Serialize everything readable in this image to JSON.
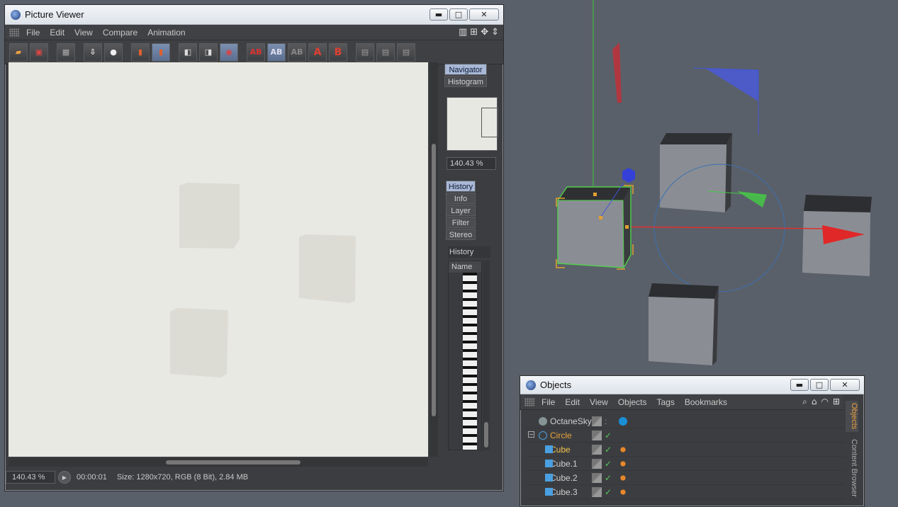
{
  "picture_viewer": {
    "title": "Picture Viewer",
    "menu": [
      "File",
      "Edit",
      "View",
      "Compare",
      "Animation"
    ],
    "window_buttons": {
      "minimize": "▬",
      "maximize": "□",
      "close": "✕"
    },
    "toolbar_tools": [
      "open-icon",
      "save-icon",
      "grid-icon",
      "export-icon",
      "user-icon",
      "film-icon",
      "filmstrip-icon",
      "view-a-icon",
      "view-b-icon",
      "view-ab-icon",
      "ab-icon",
      "ab-split-icon",
      "ab-compare-icon",
      "set-a-icon",
      "set-b-icon",
      "layout-1-icon",
      "layout-2-icon",
      "layout-3-icon"
    ],
    "tool_labels": {
      "ab": "AB",
      "a": "A",
      "b": "B"
    },
    "side_tabs": {
      "navigator": "Navigator",
      "histogram": "Histogram"
    },
    "nav_zoom": "140.43 %",
    "history_tabs": [
      "History",
      "Info",
      "Layer",
      "Filter",
      "Stereo"
    ],
    "history_label": "History",
    "history_column": "Name",
    "status": {
      "zoom": "140.43 %",
      "time": "00:00:01",
      "info": "Size: 1280x720, RGB (8 Bit), 2.84 MB"
    }
  },
  "objects": {
    "title": "Objects",
    "menu": [
      "File",
      "Edit",
      "View",
      "Objects",
      "Tags",
      "Bookmarks"
    ],
    "rows": [
      {
        "name": "OctaneSky",
        "style": "normal"
      },
      {
        "name": "Circle",
        "style": "sel"
      },
      {
        "name": "Cube",
        "style": "cube"
      },
      {
        "name": "Cube.1",
        "style": "normal"
      },
      {
        "name": "Cube.2",
        "style": "normal"
      },
      {
        "name": "Cube.3",
        "style": "normal"
      }
    ],
    "side_tabs": [
      "Objects",
      "Content Browser"
    ]
  }
}
